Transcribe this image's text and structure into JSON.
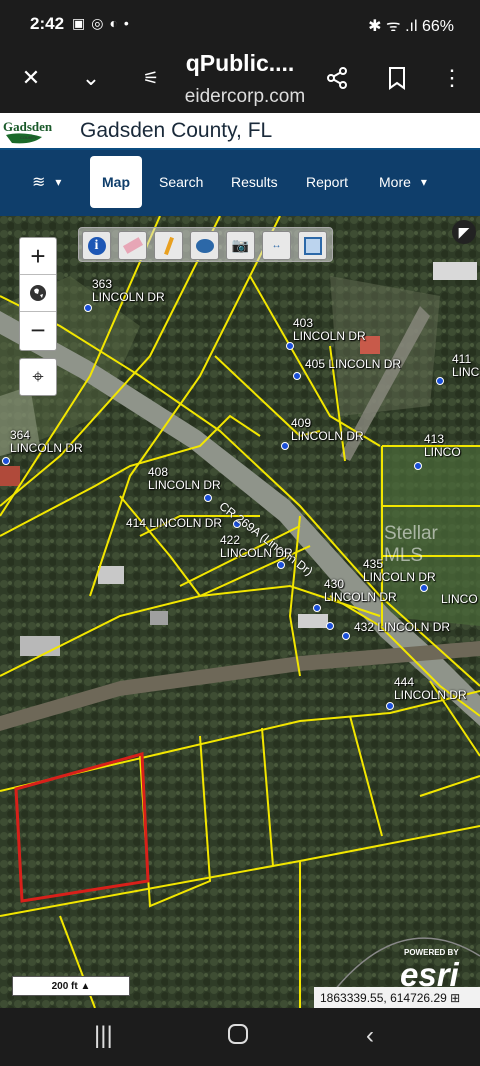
{
  "status_bar": {
    "time": "2:42",
    "left_icons": [
      "gallery-icon",
      "instagram-icon",
      "threads-icon",
      "dot-icon"
    ],
    "right_text": "✱ ᯤ .ıl 66%",
    "battery": "66%"
  },
  "browser": {
    "title": "qPublic....",
    "url": "eidercorp.com"
  },
  "site": {
    "title": "Gadsden County, FL",
    "logo_text": "Gadsden"
  },
  "nav": {
    "items": [
      {
        "label": "Map",
        "active": true
      },
      {
        "label": "Search"
      },
      {
        "label": "Results"
      },
      {
        "label": "Report"
      },
      {
        "label": "More"
      }
    ]
  },
  "map": {
    "road_label": "CR 269A (Lincoln Dr)",
    "watermark": "Stellar MLS",
    "parcels": [
      {
        "id": "p363",
        "text": "363\nLINCOLN DR"
      },
      {
        "id": "p403",
        "text": "403\nLINCOLN DR"
      },
      {
        "id": "p405",
        "text": "405 LINCOLN DR"
      },
      {
        "id": "p411",
        "text": "411\nLINC"
      },
      {
        "id": "p364",
        "text": "364\nLINCOLN DR"
      },
      {
        "id": "p409",
        "text": "409\nLINCOLN DR"
      },
      {
        "id": "p413",
        "text": "413\nLINCO"
      },
      {
        "id": "p408",
        "text": "408\nLINCOLN DR"
      },
      {
        "id": "p414",
        "text": "414 LINCOLN DR"
      },
      {
        "id": "p422",
        "text": "422\nLINCOLN DR"
      },
      {
        "id": "p435",
        "text": "435\nLINCOLN DR"
      },
      {
        "id": "pLinco",
        "text": "LINCO"
      },
      {
        "id": "p430",
        "text": "430\nLINCOLN DR"
      },
      {
        "id": "p432",
        "text": "432 LINCOLN DR"
      },
      {
        "id": "p444",
        "text": "444\nLINCOLN DR"
      }
    ],
    "scale": "200 ft",
    "powered_by": "POWERED BY",
    "esri": "esri",
    "coordinates": "1863339.55, 614726.29 ⊞",
    "colors": {
      "parcel_line": "#f2e600",
      "highlight": "#d8201a",
      "point": "#1a4fd8"
    }
  },
  "toolbar_tools": [
    "info-icon",
    "eraser-icon",
    "pencil-icon",
    "layers-globe-icon",
    "camera-icon",
    "measure-icon",
    "print-icon"
  ]
}
